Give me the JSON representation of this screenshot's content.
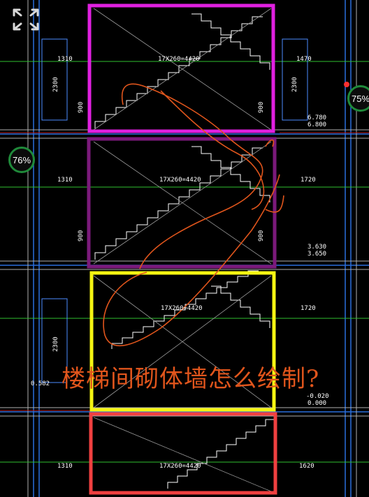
{
  "viewer": {
    "expand_icon": "expand-arrows-icon",
    "zoom_badge_left": "76%",
    "zoom_badge_right": "75%"
  },
  "drawing": {
    "stair_label": "17X260=4420",
    "dims": {
      "d1310a": "1310",
      "d1470": "1470",
      "d2300a": "2300",
      "d900a": "900",
      "d900b": "900",
      "d6780": "6.780",
      "d6800": "6.800",
      "d1310b": "1310",
      "d1720a": "1720",
      "d900c": "900",
      "d900d": "900",
      "d3630": "3.630",
      "d3650": "3.650",
      "d1720b": "1720",
      "d2300b": "2300",
      "d0582": "0.582",
      "dm020": "-0.020",
      "d0000": "0.000",
      "d1310c": "1310",
      "d1620": "1620"
    }
  },
  "annotation": {
    "question": "楼梯间砌体墙怎么绘制?"
  },
  "colors": {
    "box1": "#e020e0",
    "box2": "#7b1a7b",
    "box3": "#f5f512",
    "box4": "#f04040",
    "scribble": "#e0551c",
    "badge_ring": "#1f8a3a"
  }
}
